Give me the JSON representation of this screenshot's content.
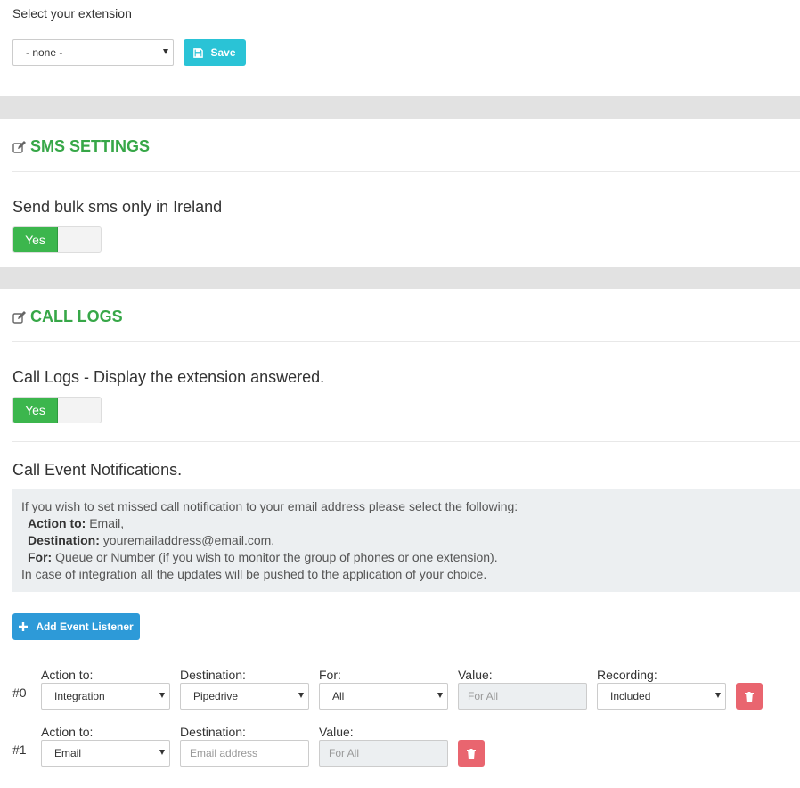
{
  "extension": {
    "label": "Select your extension",
    "selected": "- none -",
    "save_label": "Save"
  },
  "sms": {
    "title": "SMS SETTINGS",
    "bulk_label": "Send bulk sms only in Ireland",
    "toggle_label": "Yes"
  },
  "call_logs": {
    "title": "CALL LOGS",
    "display_label": "Call Logs - Display the extension answered.",
    "toggle_label": "Yes",
    "notifications_label": "Call Event Notifications.",
    "info": {
      "line1": "If you wish to set missed call notification to your email address please select the following:",
      "action_key": "Action to:",
      "action_val": " Email,",
      "dest_key": "Destination:",
      "dest_val": " youremailaddress@email.com,",
      "for_key": "For:",
      "for_val": " Queue or Number (if you wish to monitor the group of phones or one extension).",
      "line5": "In case of integration all the updates will be pushed to the application of your choice."
    },
    "add_label": "Add Event Listener"
  },
  "listeners": [
    {
      "num": "#0",
      "action_label": "Action to:",
      "action_value": "Integration",
      "destination_label": "Destination:",
      "destination_value": "Pipedrive",
      "for_label": "For:",
      "for_value": "All",
      "value_label": "Value:",
      "value_placeholder": "For All",
      "recording_label": "Recording:",
      "recording_value": "Included"
    },
    {
      "num": "#1",
      "action_label": "Action to:",
      "action_value": "Email",
      "destination_label": "Destination:",
      "destination_placeholder": "Email address",
      "value_label": "Value:",
      "value_placeholder": "For All"
    }
  ]
}
